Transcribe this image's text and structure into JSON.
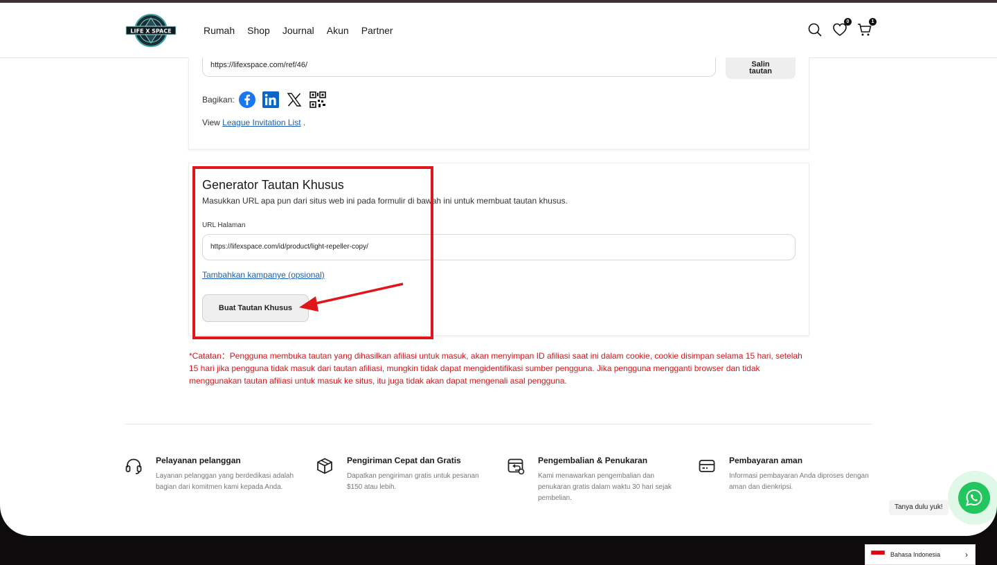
{
  "header": {
    "logo_text": "LIFE X SPACE",
    "nav": [
      "Rumah",
      "Shop",
      "Journal",
      "Akun",
      "Partner"
    ],
    "wishlist_count": "0",
    "cart_count": "1"
  },
  "referral": {
    "link": "https://lifexspace.com/ref/46/",
    "copy_label_line1": "Salin",
    "copy_label_line2": "tautan",
    "share_label": "Bagikan:",
    "view_prefix": "View ",
    "view_link": "League Invitation List",
    "view_suffix": " ."
  },
  "generator": {
    "title": "Generator Tautan Khusus",
    "description": "Masukkan URL apa pun dari situs web ini pada formulir di bawah ini untuk membuat tautan khusus.",
    "url_label": "URL Halaman",
    "url_value": "https://lifexspace.com/id/product/light-repeller-copy/",
    "campaign_link": "Tambahkan kampanye (opsional)",
    "button": "Buat Tautan Khusus"
  },
  "note": "*Catatan：Pengguna membuka tautan yang dihasilkan afiliasi untuk masuk, akan menyimpan ID afiliasi saat ini dalam cookie, cookie disimpan selama 15 hari, setelah 15 hari jika pengguna tidak masuk dari tautan afiliasi, mungkin tidak dapat mengidentifikasi sumber pengguna. Jika pengguna mengganti browser dan tidak menggunakan tautan afiliasi untuk masuk ke situs, itu juga tidak akan dapat mengenali asal pengguna.",
  "features": [
    {
      "title": "Pelayanan pelanggan",
      "desc": "Layanan pelanggan yang berdedikasi adalah bagian dari komitmen kami kepada Anda.",
      "icon": "headset-icon"
    },
    {
      "title": "Pengiriman Cepat dan Gratis",
      "desc": "Dapatkan pengiriman gratis untuk pesanan $150 atau lebih.",
      "icon": "box-icon"
    },
    {
      "title": "Pengembalian & Penukaran",
      "desc": "Kami menawarkan pengembalian dan penukaran gratis dalam waktu 30 hari sejak pembelian.",
      "icon": "return-icon"
    },
    {
      "title": "Pembayaran aman",
      "desc": "Informasi pembayaran Anda diproses dengan aman dan dienkripsi.",
      "icon": "card-icon"
    }
  ],
  "chat": {
    "bubble": "Tanya dulu yuk!"
  },
  "language": {
    "label": "Bahasa Indonesia"
  },
  "colors": {
    "accent_red": "#e0161b",
    "link_blue": "#1a5fb4",
    "whatsapp_green": "#22c55e"
  }
}
